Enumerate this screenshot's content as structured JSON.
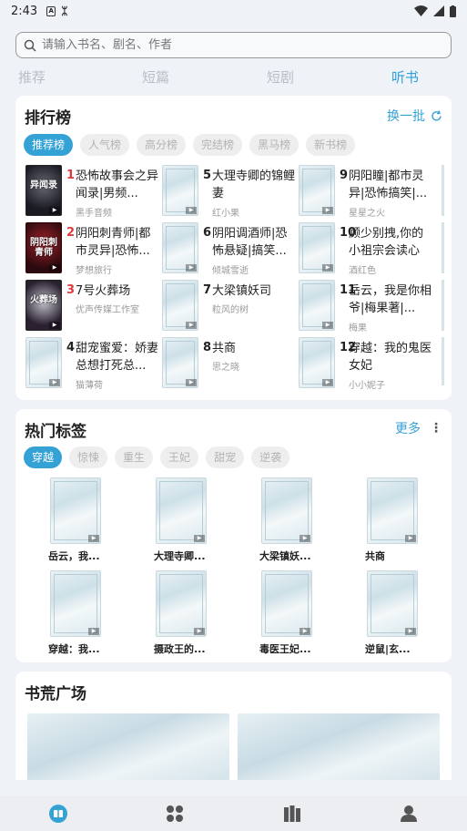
{
  "status": {
    "time": "2:43"
  },
  "search": {
    "placeholder": "请输入书名、剧名、作者"
  },
  "top_tabs": [
    {
      "label": "推荐",
      "active": false
    },
    {
      "label": "短篇",
      "active": false
    },
    {
      "label": "短剧",
      "active": false
    },
    {
      "label": "听书",
      "active": true
    }
  ],
  "ranking": {
    "title": "排行榜",
    "refresh_label": "换一批",
    "pills": [
      "推荐榜",
      "人气榜",
      "高分榜",
      "完结榜",
      "黑马榜",
      "新书榜"
    ],
    "items": [
      {
        "num": "1",
        "title": "恐怖故事会之异闻录|男频...",
        "author": "黑手音频",
        "cover_text": "异闻录"
      },
      {
        "num": "2",
        "title": "阴阳刺青师|都市灵异|恐怖...",
        "author": "梦想旅行",
        "cover_text": "阴阳刺青师"
      },
      {
        "num": "3",
        "title": "7号火葬场",
        "author": "优声传媒工作室",
        "cover_text": "火葬场"
      },
      {
        "num": "4",
        "title": "甜宠蜜爱：娇妻总想打死总...",
        "author": "猫薄荷",
        "cover_text": ""
      },
      {
        "num": "5",
        "title": "大理寺卿的锦鲤妻",
        "author": "红小果",
        "cover_text": ""
      },
      {
        "num": "6",
        "title": "阴阳调酒师|恐怖悬疑|搞笑...",
        "author": "倾城雪逝",
        "cover_text": ""
      },
      {
        "num": "7",
        "title": "大梁镇妖司",
        "author": "粒风的树",
        "cover_text": ""
      },
      {
        "num": "8",
        "title": "共商",
        "author": "思之晓",
        "cover_text": ""
      },
      {
        "num": "9",
        "title": "阴阳瞳|都市灵异|恐怖搞笑|...",
        "author": "星星之火",
        "cover_text": ""
      },
      {
        "num": "10",
        "title": "顾少别拽,你的小祖宗会读心",
        "author": "酒红色",
        "cover_text": ""
      },
      {
        "num": "11",
        "title": "岳云，我是你相爷|梅果著|...",
        "author": "梅果",
        "cover_text": ""
      },
      {
        "num": "12",
        "title": "穿越：我的鬼医女妃",
        "author": "小小妮子",
        "cover_text": ""
      }
    ]
  },
  "hot_tags": {
    "title": "热门标签",
    "more_label": "更多",
    "pills": [
      "穿越",
      "惊悚",
      "重生",
      "王妃",
      "甜宠",
      "逆袭"
    ],
    "items": [
      "岳云，我...",
      "大理寺卿...",
      "大梁镇妖...",
      "共商",
      "穿越：我...",
      "摄政王的...",
      "毒医王妃...",
      "逆鼠|玄..."
    ]
  },
  "plaza": {
    "title": "书荒广场"
  },
  "colors": {
    "accent": "#35a2d6",
    "hot_rank": "#e0393c"
  },
  "bottom_nav": [
    "book-icon",
    "grid-icon",
    "library-icon",
    "user-icon"
  ]
}
